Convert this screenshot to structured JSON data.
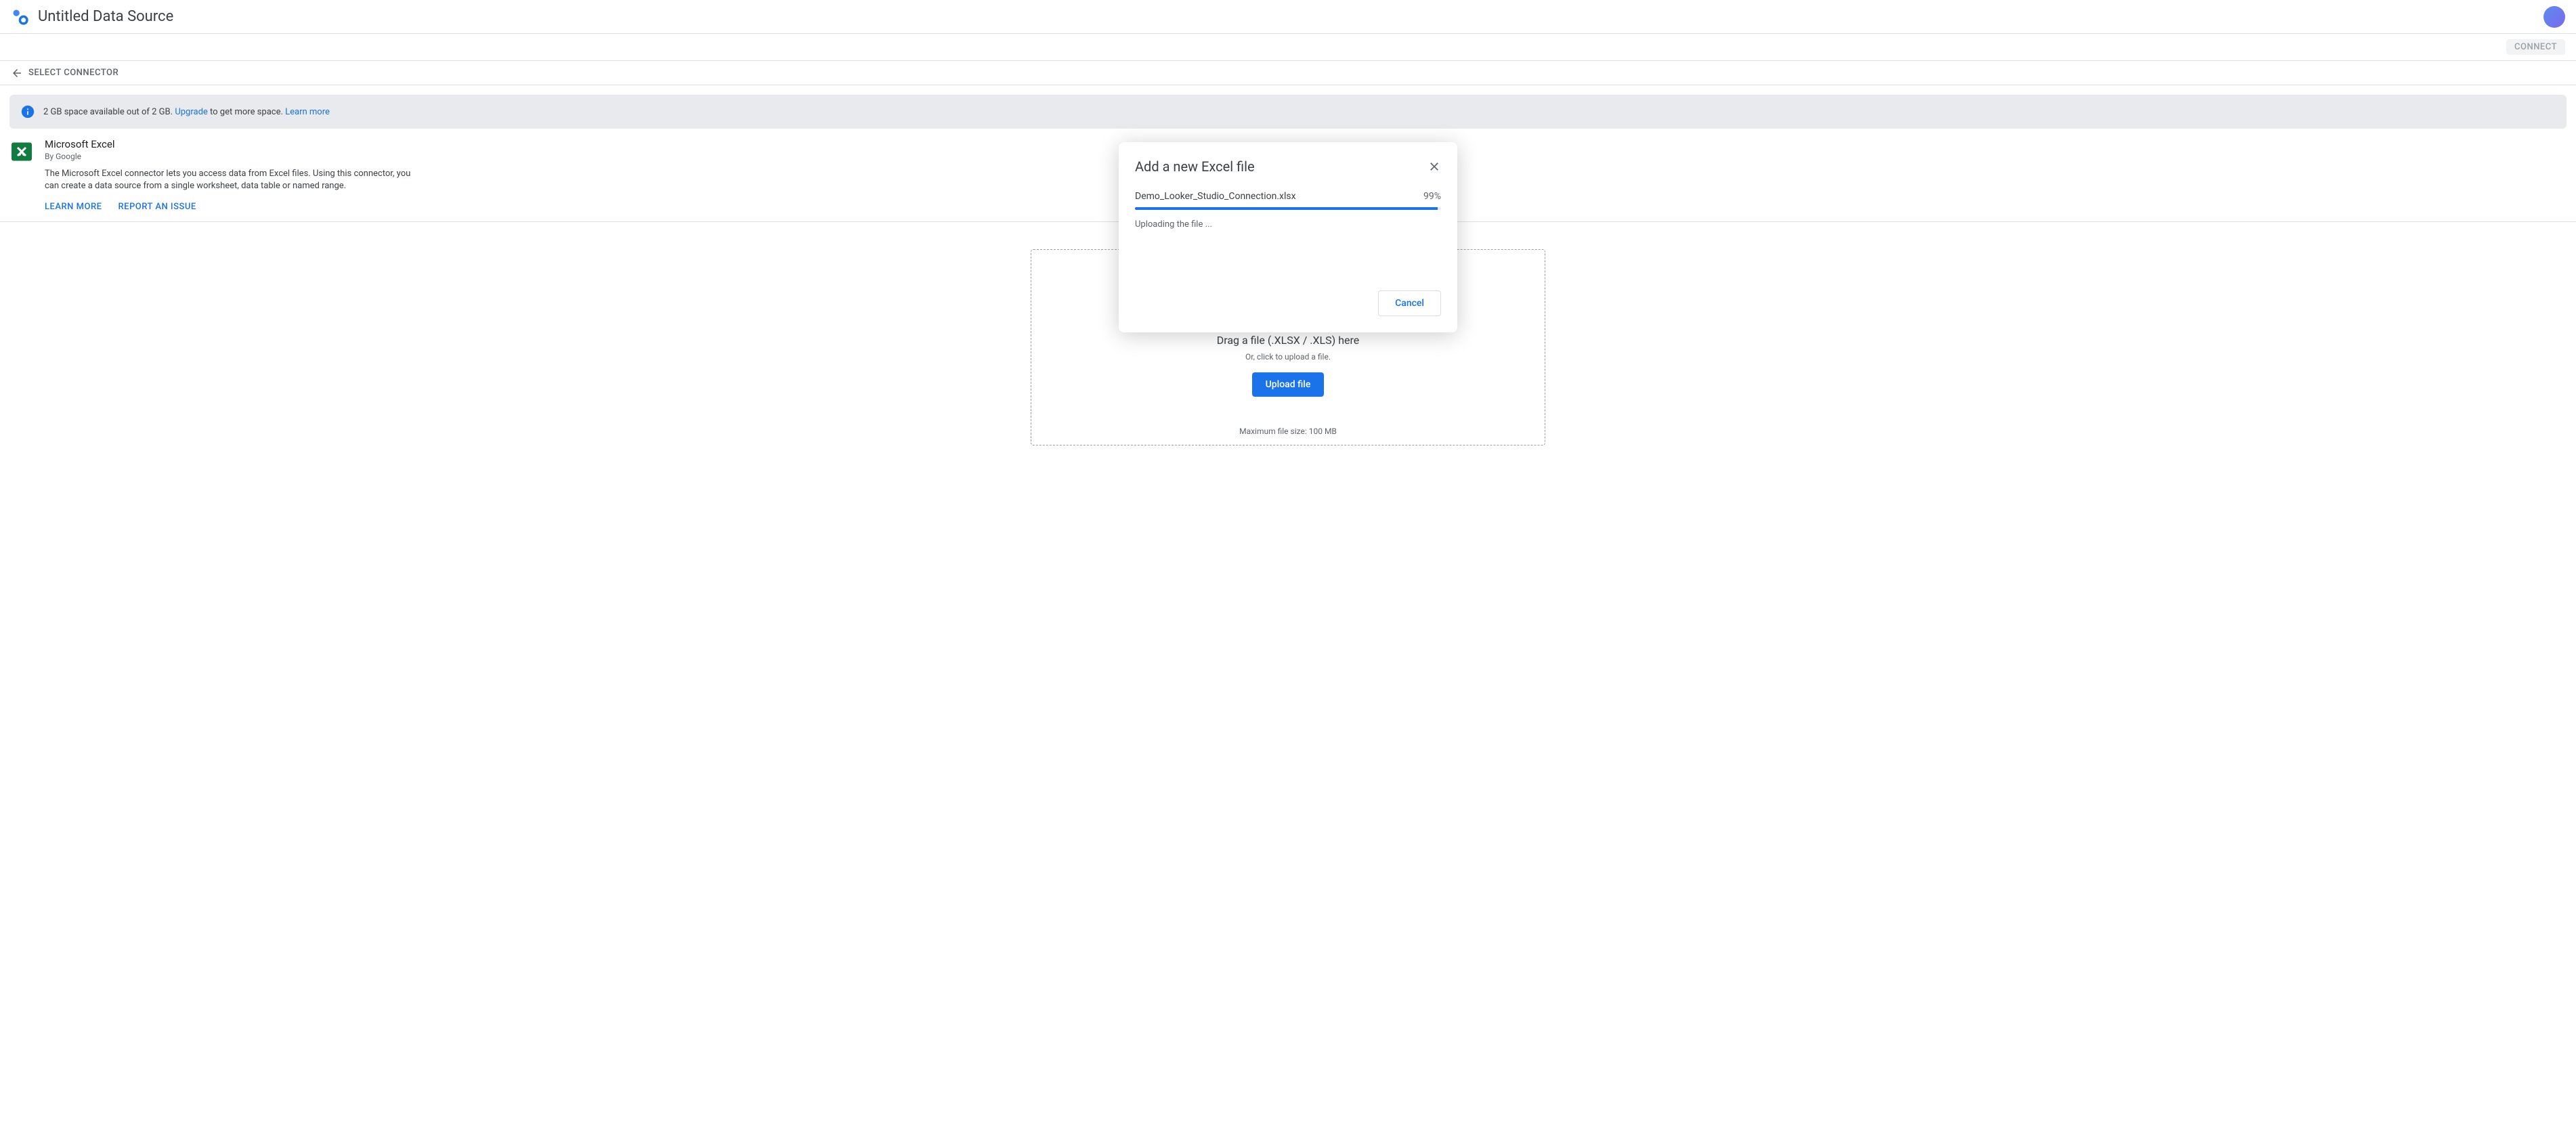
{
  "header": {
    "title": "Untitled Data Source"
  },
  "toolbar": {
    "connect_label": "CONNECT"
  },
  "breadcrumb": {
    "label": "SELECT CONNECTOR"
  },
  "banner": {
    "text": "2 GB space available out of 2 GB.",
    "upgrade_text": "Upgrade",
    "text_suffix": " to get more space. ",
    "learn_more": "Learn more"
  },
  "connector": {
    "title": "Microsoft Excel",
    "by": "By Google",
    "description": "The Microsoft Excel connector lets you access data from Excel files. Using this connector, you can create a data source from a single worksheet, data table or named range.",
    "learn_more": "LEARN MORE",
    "report_issue": "REPORT AN ISSUE"
  },
  "dropzone": {
    "title": "Drag a file (.XLSX / .XLS) here",
    "subtitle": "Or, click to upload a file.",
    "upload_label": "Upload file",
    "max_size": "Maximum file size: 100 MB"
  },
  "modal": {
    "title": "Add a new Excel file",
    "filename": "Demo_Looker_Studio_Connection.xlsx",
    "percent": "99%",
    "progress_width": "99%",
    "status": "Uploading the file ...",
    "cancel_label": "Cancel"
  }
}
